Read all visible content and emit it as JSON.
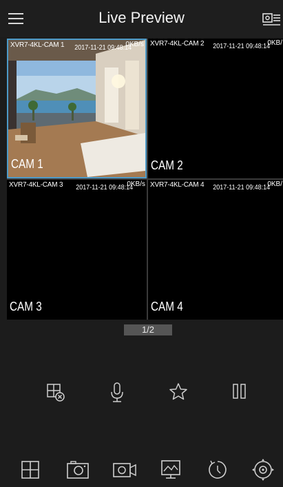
{
  "header": {
    "title": "Live Preview",
    "menu_icon": "hamburger-menu-icon",
    "right_icon": "device-list-icon"
  },
  "cameras": [
    {
      "name": "XVR7-4KL-CAM 1",
      "time": "2017-11-21 09:48:14",
      "rate": "0KB/s",
      "label": "CAM 1",
      "selected": true
    },
    {
      "name": "XVR7-4KL-CAM 2",
      "time": "2017-11-21 09:48:14",
      "rate": "0KB/",
      "label": "CAM 2",
      "selected": false
    },
    {
      "name": "XVR7-4KL-CAM 3",
      "time": "2017-11-21 09:48:14",
      "rate": "0KB/s",
      "label": "CAM 3",
      "selected": false
    },
    {
      "name": "XVR7-4KL-CAM 4",
      "time": "2017-11-21 09:48:14",
      "rate": "0KB/",
      "label": "CAM 4",
      "selected": false
    }
  ],
  "pagination": {
    "text": "1/2"
  },
  "controls": [
    "close-window-icon",
    "microphone-icon",
    "favorite-star-icon",
    "pause-icon"
  ],
  "toolbar": [
    "split-screen-icon",
    "snapshot-camera-icon",
    "record-video-icon",
    "image-quality-icon",
    "playback-icon",
    "ptz-control-icon"
  ],
  "colors": {
    "selection_border": "#4d9bc9",
    "background": "#1c1c1c",
    "icon": "#cfcfcf"
  }
}
